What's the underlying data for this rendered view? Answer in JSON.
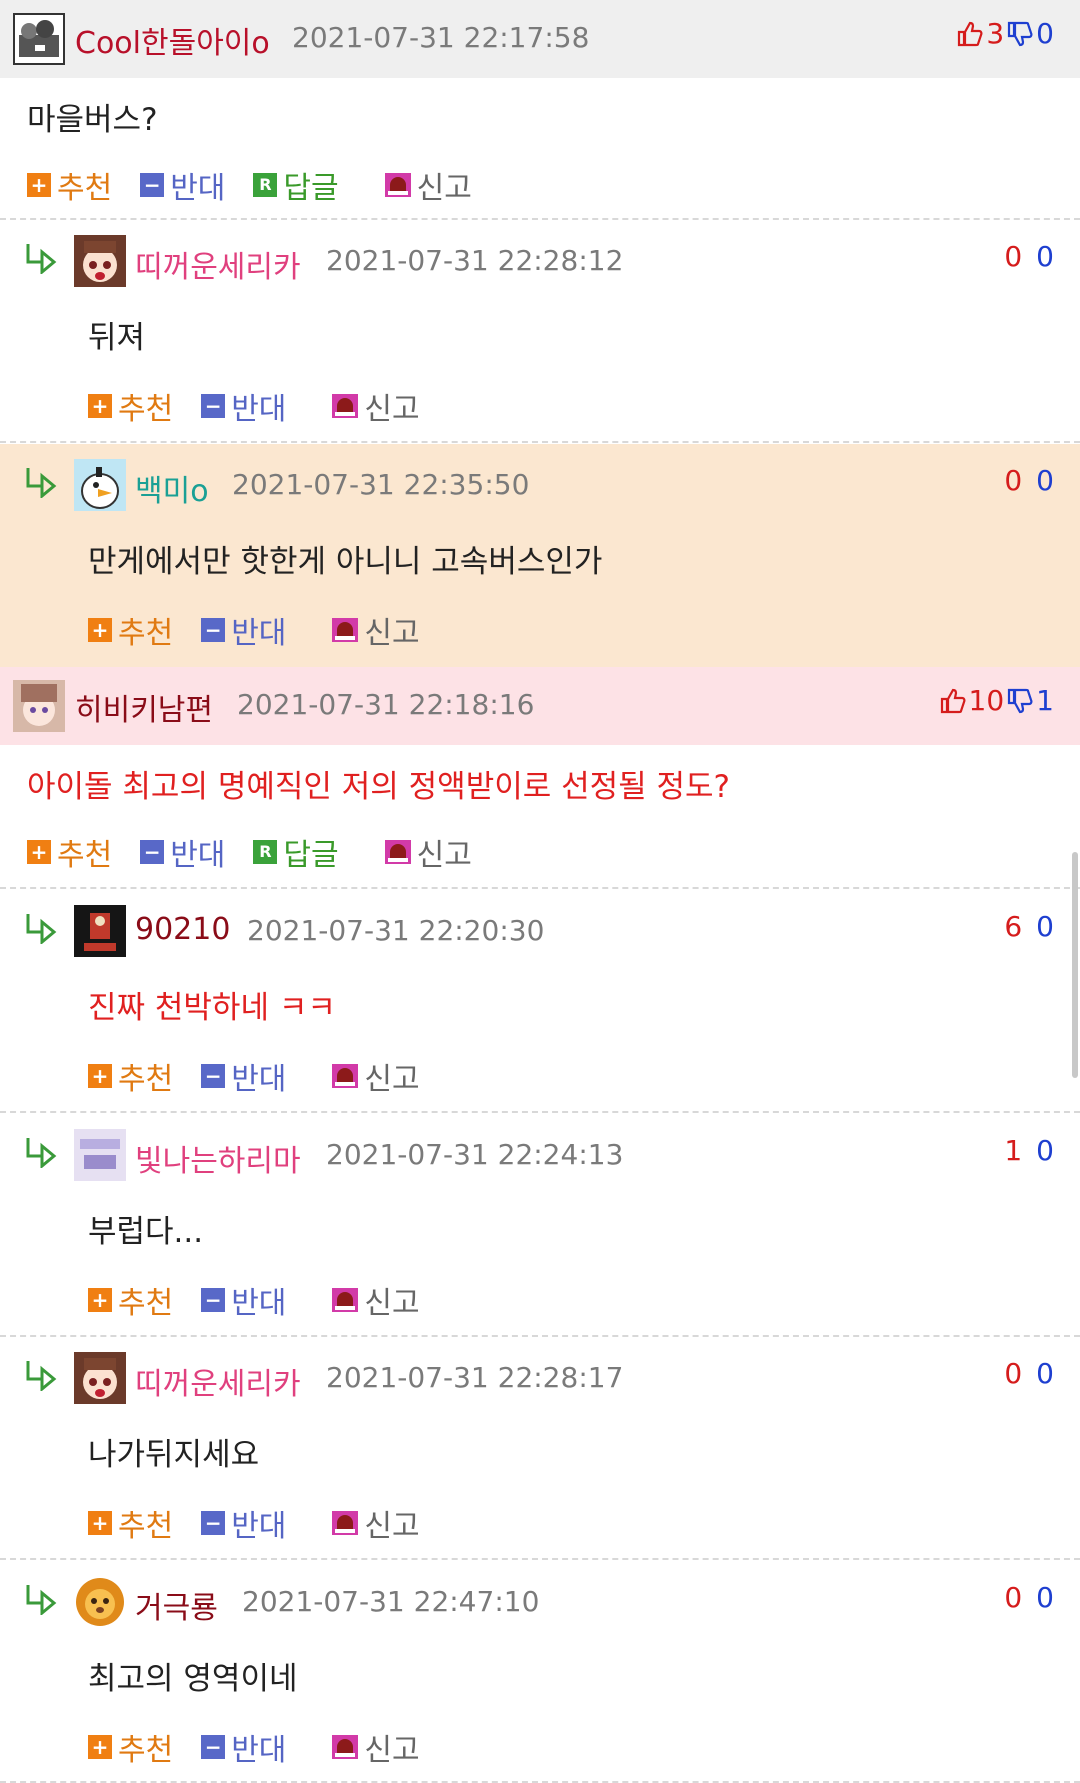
{
  "actions": {
    "recommend": "추천",
    "oppose": "반대",
    "reply": "답글",
    "report": "신고"
  },
  "comments": [
    {
      "nick": "Cool한돌아이o",
      "date": "2021-07-31 22:17:58",
      "up": "3",
      "down": "0",
      "text": "마을버스?"
    },
    {
      "nick": "띠꺼운세리카",
      "date": "2021-07-31 22:28:12",
      "up": "0",
      "down": "0",
      "text": "뒤져"
    },
    {
      "nick": "백미o",
      "date": "2021-07-31 22:35:50",
      "up": "0",
      "down": "0",
      "text": "만게에서만 핫한게 아니니 고속버스인가"
    },
    {
      "nick": "히비키남편",
      "date": "2021-07-31 22:18:16",
      "up": "10",
      "down": "1",
      "text": "아이돌 최고의 명예직인 저의 정액받이로 선정될 정도?"
    },
    {
      "nick": "90210",
      "date": "2021-07-31 22:20:30",
      "up": "6",
      "down": "0",
      "text": "진짜 천박하네 ㅋㅋ"
    },
    {
      "nick": "빛나는하리마",
      "date": "2021-07-31 22:24:13",
      "up": "1",
      "down": "0",
      "text": "부럽다..."
    },
    {
      "nick": "띠꺼운세리카",
      "date": "2021-07-31 22:28:17",
      "up": "0",
      "down": "0",
      "text": "나가뒤지세요"
    },
    {
      "nick": "거극룡",
      "date": "2021-07-31 22:47:10",
      "up": "0",
      "down": "0",
      "text": "최고의 영역이네"
    }
  ],
  "colors": {
    "nick_red": "#b8102a",
    "nick_pink": "#e0407e",
    "nick_teal": "#1aa095",
    "nick_dark_red": "#8a0c18",
    "recommend": "#e07a12",
    "oppose": "#5565c4",
    "reply": "#3a9a2a",
    "highlight_orange": "#fbe7d0",
    "highlight_pink": "#fde2e6"
  }
}
